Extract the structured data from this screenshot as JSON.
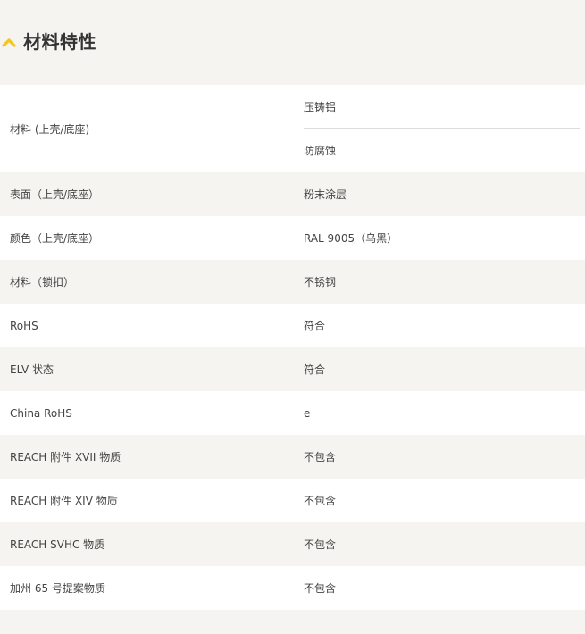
{
  "section": {
    "title": "材料特性",
    "icon": "chevron-up-icon",
    "accent_color": "#f5c518"
  },
  "table": {
    "rows": [
      {
        "label": "材料 (上壳/底座)",
        "values": [
          "压铸铝",
          "防腐蚀"
        ]
      },
      {
        "label": "表面（上壳/底座）",
        "value": "粉末涂层"
      },
      {
        "label": "颜色（上壳/底座）",
        "value": "RAL 9005（乌黑）"
      },
      {
        "label": "材料（锁扣）",
        "value": "不锈钢"
      },
      {
        "label": "RoHS",
        "value": "符合"
      },
      {
        "label": "ELV 状态",
        "value": "符合"
      },
      {
        "label": "China RoHS",
        "value": "e"
      },
      {
        "label": "REACH 附件 XVII 物质",
        "value": "不包含"
      },
      {
        "label": "REACH 附件 XIV 物质",
        "value": "不包含"
      },
      {
        "label": "REACH SVHC 物质",
        "value": "不包含"
      },
      {
        "label": "加州 65 号提案物质",
        "value": "不包含"
      }
    ]
  }
}
